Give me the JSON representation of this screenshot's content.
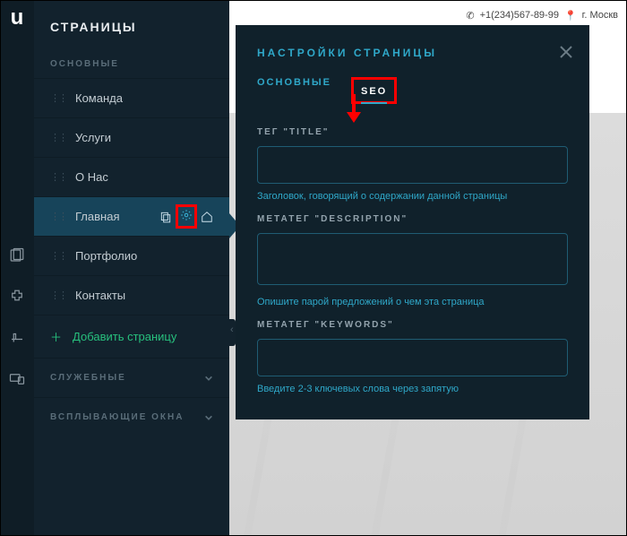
{
  "header": {
    "phone": "+1(234)567-89-99",
    "city": "г. Москв"
  },
  "rail": {
    "logo": "u"
  },
  "pages": {
    "title": "СТРАНИЦЫ",
    "section_main": "ОСНОВНЫЕ",
    "items": [
      "Команда",
      "Услуги",
      "О Нас",
      "Главная",
      "Портфолио",
      "Контакты"
    ],
    "add": "Добавить страницу",
    "group_service": "СЛУЖЕБНЫЕ",
    "group_popups": "ВСПЛЫВАЮЩИЕ ОКНА"
  },
  "dialog": {
    "title": "НАСТРОЙКИ СТРАНИЦЫ",
    "tab_main": "ОСНОВНЫЕ",
    "tab_seo": "SEO",
    "f_title_label": "ТЕГ \"TITLE\"",
    "f_title_hint": "Заголовок, говорящий о содержании данной страницы",
    "f_desc_label": "МЕТАТЕГ \"DESCRIPTION\"",
    "f_desc_hint": "Опишите парой предложений о чем эта страница",
    "f_kw_label": "МЕТАТЕГ \"KEYWORDS\"",
    "f_kw_hint": "Введите 2-3 ключевых слова через запятую"
  }
}
